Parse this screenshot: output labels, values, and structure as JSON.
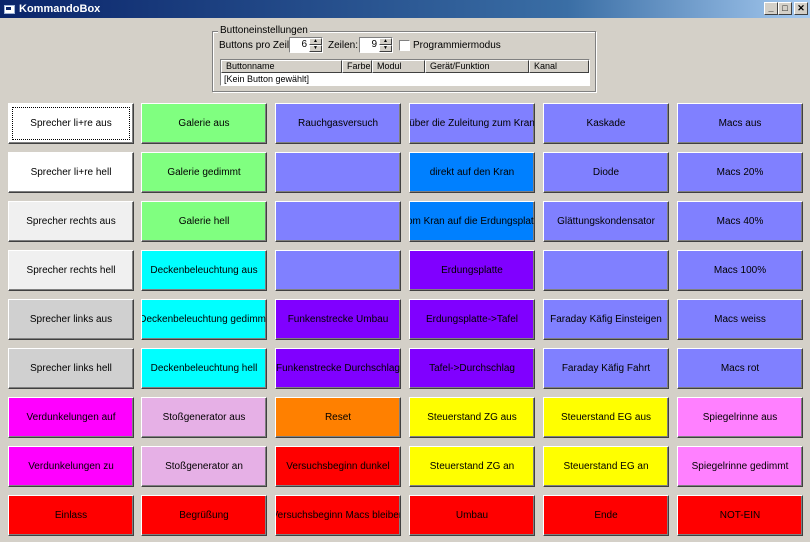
{
  "window": {
    "title": "KommandoBox"
  },
  "settings": {
    "group_title": "Buttoneinstellungen",
    "buttons_per_row_label": "Buttons pro Zeile:",
    "buttons_per_row_value": "6",
    "rows_label": "Zeilen:",
    "rows_value": "9",
    "program_mode_label": "Programmiermodus",
    "program_mode_checked": false,
    "columns": [
      "Buttonname",
      "Farbe",
      "Modul",
      "Gerät/Funktion",
      "Kanal"
    ],
    "row_text": "[Kein Button gewählt]"
  },
  "grid": {
    "rows": [
      [
        {
          "label": "Sprecher li+re aus",
          "color": "#ffffff",
          "text": "#000000",
          "focused": true
        },
        {
          "label": "Galerie aus",
          "color": "#80ff80",
          "text": "#000000"
        },
        {
          "label": "Rauchgasversuch",
          "color": "#8080ff",
          "text": "#000000"
        },
        {
          "label": "über die Zuleitung zum Kran",
          "color": "#8080ff",
          "text": "#000000"
        },
        {
          "label": "Kaskade",
          "color": "#8080ff",
          "text": "#000000"
        },
        {
          "label": "Macs aus",
          "color": "#8080ff",
          "text": "#000000"
        }
      ],
      [
        {
          "label": "Sprecher li+re hell",
          "color": "#ffffff",
          "text": "#000000"
        },
        {
          "label": "Galerie gedimmt",
          "color": "#80ff80",
          "text": "#000000"
        },
        {
          "label": "",
          "color": "#8080ff",
          "text": "#000000"
        },
        {
          "label": "direkt auf den Kran",
          "color": "#0080ff",
          "text": "#000000"
        },
        {
          "label": "Diode",
          "color": "#8080ff",
          "text": "#000000"
        },
        {
          "label": "Macs 20%",
          "color": "#8080ff",
          "text": "#000000"
        }
      ],
      [
        {
          "label": "Sprecher rechts aus",
          "color": "#f0f0f0",
          "text": "#000000"
        },
        {
          "label": "Galerie hell",
          "color": "#80ff80",
          "text": "#000000"
        },
        {
          "label": "",
          "color": "#8080ff",
          "text": "#000000"
        },
        {
          "label": "vom Kran auf die Erdungsplatte",
          "color": "#0080ff",
          "text": "#000000"
        },
        {
          "label": "Glättungskondensator",
          "color": "#8080ff",
          "text": "#000000"
        },
        {
          "label": "Macs 40%",
          "color": "#8080ff",
          "text": "#000000"
        }
      ],
      [
        {
          "label": "Sprecher rechts hell",
          "color": "#f0f0f0",
          "text": "#000000"
        },
        {
          "label": "Deckenbeleuchtung aus",
          "color": "#00ffff",
          "text": "#000000"
        },
        {
          "label": "",
          "color": "#8080ff",
          "text": "#000000"
        },
        {
          "label": "Erdungsplatte",
          "color": "#8000ff",
          "text": "#000000"
        },
        {
          "label": "",
          "color": "#8080ff",
          "text": "#000000"
        },
        {
          "label": "Macs 100%",
          "color": "#8080ff",
          "text": "#000000"
        }
      ],
      [
        {
          "label": "Sprecher links aus",
          "color": "#d0d0d0",
          "text": "#000000"
        },
        {
          "label": "Deckenbeleuchtung gedimmt",
          "color": "#00ffff",
          "text": "#000000"
        },
        {
          "label": "Funkenstrecke Umbau",
          "color": "#8000ff",
          "text": "#000000"
        },
        {
          "label": "Erdungsplatte->Tafel",
          "color": "#8000ff",
          "text": "#000000"
        },
        {
          "label": "Faraday Käfig Einsteigen",
          "color": "#8080ff",
          "text": "#000000"
        },
        {
          "label": "Macs weiss",
          "color": "#8080ff",
          "text": "#000000"
        }
      ],
      [
        {
          "label": "Sprecher links hell",
          "color": "#d0d0d0",
          "text": "#000000"
        },
        {
          "label": "Deckenbeleuchtung hell",
          "color": "#00ffff",
          "text": "#000000"
        },
        {
          "label": "Funkenstrecke Durchschlag",
          "color": "#8000ff",
          "text": "#000000"
        },
        {
          "label": "Tafel->Durchschlag",
          "color": "#8000ff",
          "text": "#000000"
        },
        {
          "label": "Faraday Käfig Fahrt",
          "color": "#8080ff",
          "text": "#000000"
        },
        {
          "label": "Macs rot",
          "color": "#8080ff",
          "text": "#000000"
        }
      ],
      [
        {
          "label": "Verdunkelungen auf",
          "color": "#ff00ff",
          "text": "#000000"
        },
        {
          "label": "Stoßgenerator aus",
          "color": "#e6b0e6",
          "text": "#000000"
        },
        {
          "label": "Reset",
          "color": "#ff8000",
          "text": "#000000"
        },
        {
          "label": "Steuerstand ZG aus",
          "color": "#ffff00",
          "text": "#000000"
        },
        {
          "label": "Steuerstand EG aus",
          "color": "#ffff00",
          "text": "#000000"
        },
        {
          "label": "Spiegelrinne aus",
          "color": "#ff80ff",
          "text": "#000000"
        }
      ],
      [
        {
          "label": "Verdunkelungen zu",
          "color": "#ff00ff",
          "text": "#000000"
        },
        {
          "label": "Stoßgenerator an",
          "color": "#e6b0e6",
          "text": "#000000"
        },
        {
          "label": "Versuchsbeginn dunkel",
          "color": "#ff0000",
          "text": "#000000"
        },
        {
          "label": "Steuerstand ZG an",
          "color": "#ffff00",
          "text": "#000000"
        },
        {
          "label": "Steuerstand EG an",
          "color": "#ffff00",
          "text": "#000000"
        },
        {
          "label": "Spiegelrinne gedimmt",
          "color": "#ff80ff",
          "text": "#000000"
        }
      ],
      [
        {
          "label": "Einlass",
          "color": "#ff0000",
          "text": "#000000"
        },
        {
          "label": "Begrüßung",
          "color": "#ff0000",
          "text": "#000000"
        },
        {
          "label": "Versuchsbeginn Macs bleiben",
          "color": "#ff0000",
          "text": "#000000"
        },
        {
          "label": "Umbau",
          "color": "#ff0000",
          "text": "#000000"
        },
        {
          "label": "Ende",
          "color": "#ff0000",
          "text": "#000000"
        },
        {
          "label": "NOT-EIN",
          "color": "#ff0000",
          "text": "#000000"
        }
      ]
    ]
  }
}
